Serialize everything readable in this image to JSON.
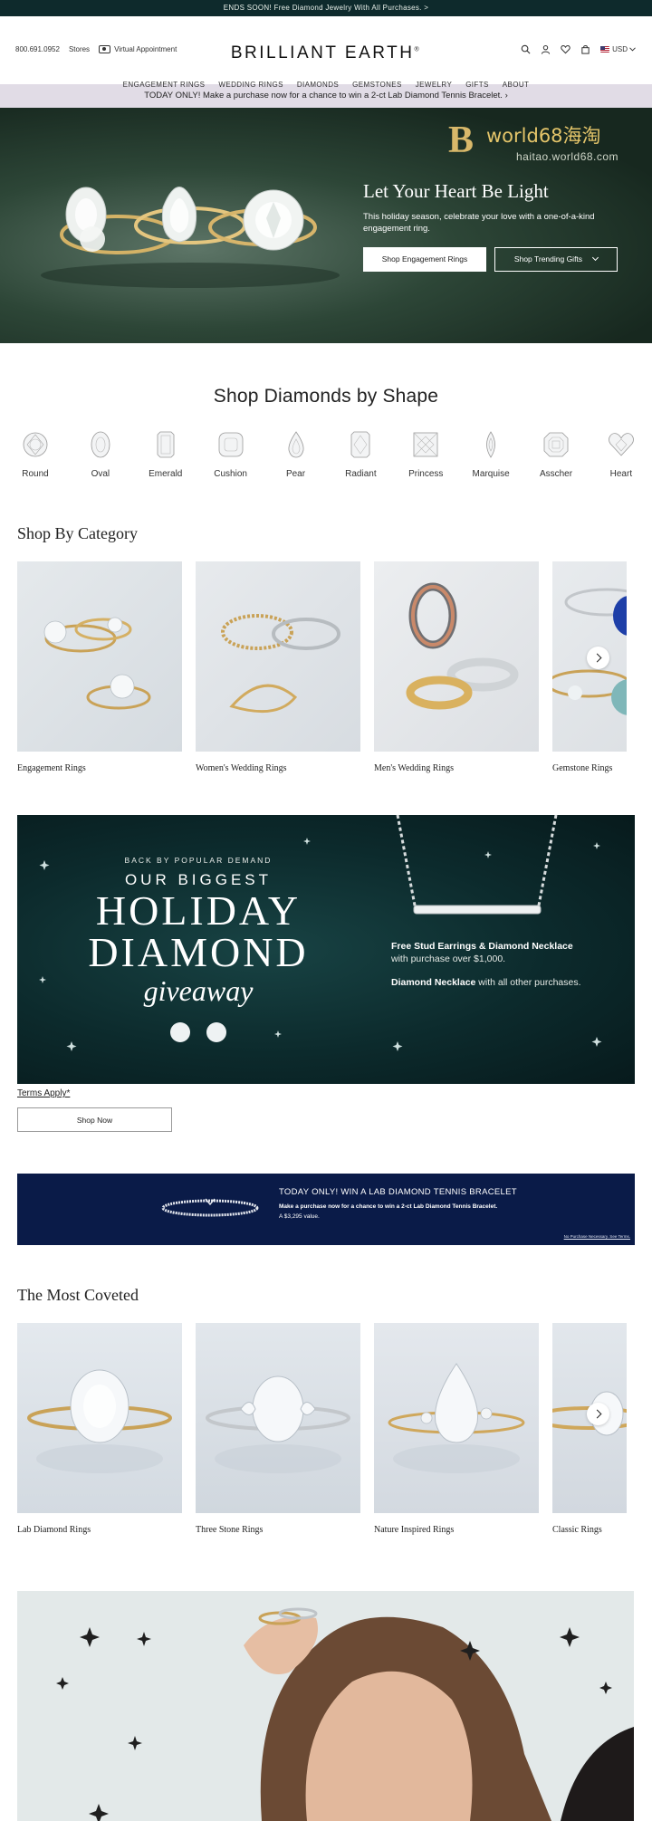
{
  "announcement": "ENDS SOON! Free Diamond Jewelry With All Purchases. >",
  "header": {
    "phone": "800.691.0952",
    "stores": "Stores",
    "virtual_appointment": "Virtual Appointment",
    "logo": "BRILLIANT EARTH",
    "logo_mark": "®",
    "currency": "USD"
  },
  "nav": [
    "ENGAGEMENT RINGS",
    "WEDDING RINGS",
    "DIAMONDS",
    "GEMSTONES",
    "JEWELRY",
    "GIFTS",
    "ABOUT"
  ],
  "promo_bar": "TODAY ONLY! Make a purchase now for a chance to win a 2-ct Lab Diamond Tennis Bracelet.  ›",
  "hero": {
    "title": "Let Your Heart Be Light",
    "text": "This holiday season, celebrate your love with a one-of-a-kind engagement ring.",
    "button_primary": "Shop Engagement Rings",
    "button_secondary": "Shop Trending Gifts"
  },
  "watermark": {
    "logo": "B",
    "line1": "world68海淘",
    "line2": "haitao.world68.com"
  },
  "shapes": {
    "title": "Shop Diamonds by Shape",
    "items": [
      "Round",
      "Oval",
      "Emerald",
      "Cushion",
      "Pear",
      "Radiant",
      "Princess",
      "Marquise",
      "Asscher",
      "Heart"
    ]
  },
  "category": {
    "title": "Shop By Category",
    "items": [
      "Engagement Rings",
      "Women's Wedding Rings",
      "Men's Wedding Rings",
      "Gemstone Rings"
    ]
  },
  "giveaway": {
    "line1": "BACK BY POPULAR DEMAND",
    "line2": "OUR BIGGEST",
    "line3": "HOLIDAY",
    "line4": "DIAMOND",
    "line5": "giveaway",
    "offer1_bold": "Free Stud Earrings & Diamond Necklace",
    "offer1_rest": "with purchase over $1,000.",
    "offer2_bold": "Diamond Necklace",
    "offer2_rest": " with all other purchases.",
    "terms": "Terms Apply*",
    "button": "Shop Now"
  },
  "tennis": {
    "title": "TODAY ONLY! WIN A LAB DIAMOND TENNIS BRACELET",
    "line1": "Make a purchase now for a chance to win a 2-ct Lab Diamond Tennis Bracelet.",
    "line2": "A $3,295 value.",
    "fine_print": "No Purchase Necessary. See Terms."
  },
  "coveted": {
    "title": "The Most Coveted",
    "items": [
      "Lab Diamond Rings",
      "Three Stone Rings",
      "Nature Inspired Rings",
      "Classic Rings"
    ]
  },
  "colors": {
    "announce_bg": "#0e2a2c",
    "promo_bg": "#e1dce6",
    "giveaway_bg": "#0c2a2c",
    "tennis_bg": "#0a1b48"
  }
}
